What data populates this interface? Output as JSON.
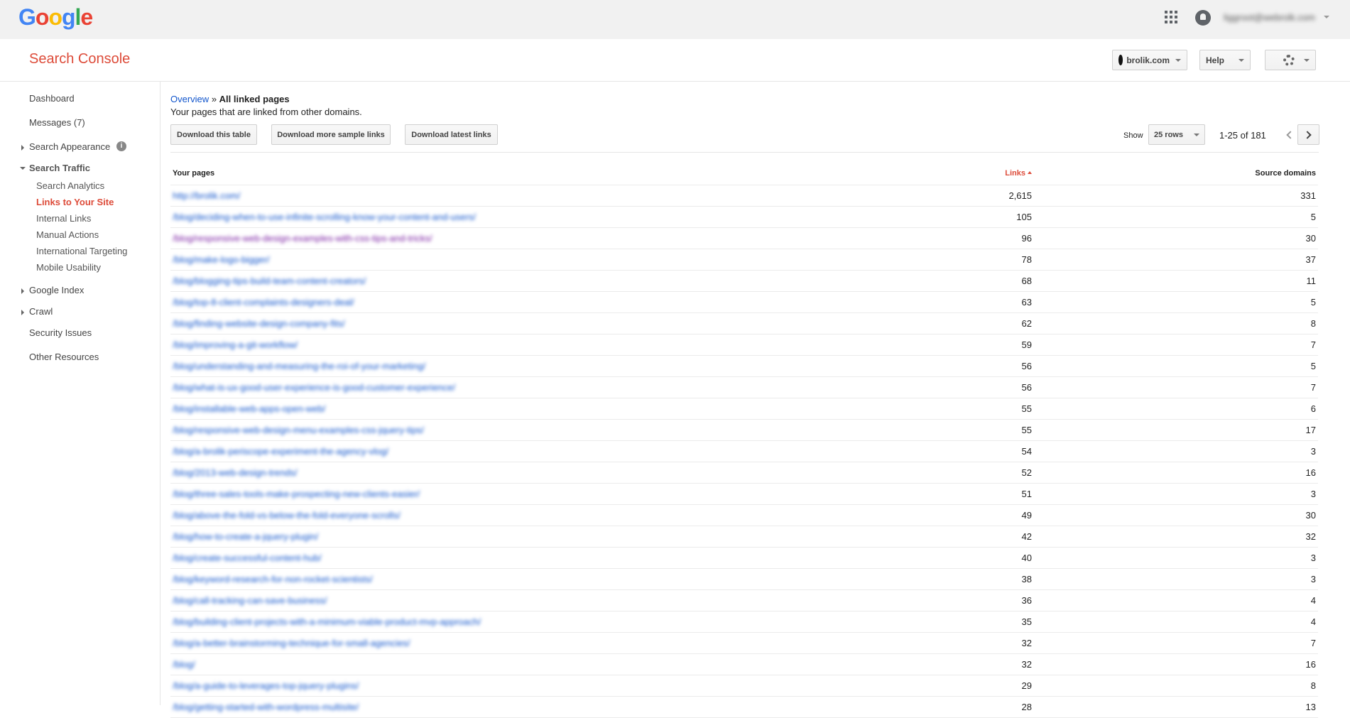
{
  "topbar": {
    "logo_letters": [
      {
        "ch": "G",
        "color": "#4285f4"
      },
      {
        "ch": "o",
        "color": "#ea4335"
      },
      {
        "ch": "o",
        "color": "#fbbc05"
      },
      {
        "ch": "g",
        "color": "#4285f4"
      },
      {
        "ch": "l",
        "color": "#34a853"
      },
      {
        "ch": "e",
        "color": "#ea4335"
      }
    ],
    "icons": [
      "apps-grid-icon",
      "notifications-icon"
    ],
    "account_email": "liggroot@webrolk.com"
  },
  "header": {
    "title": "Search Console",
    "site_label": "brolik.com",
    "help_label": "Help",
    "brand_color": "#dd4b39"
  },
  "sidebar": {
    "dashboard": "Dashboard",
    "messages": "Messages (7)",
    "search_appearance": "Search Appearance",
    "search_traffic": "Search Traffic",
    "search_traffic_items": [
      "Search Analytics",
      "Links to Your Site",
      "Internal Links",
      "Manual Actions",
      "International Targeting",
      "Mobile Usability"
    ],
    "active_item": "Links to Your Site",
    "google_index": "Google Index",
    "crawl": "Crawl",
    "security_issues": "Security Issues",
    "other_resources": "Other Resources"
  },
  "main": {
    "breadcrumb": {
      "overview": "Overview",
      "separator": "»",
      "current": "All linked pages"
    },
    "description": "Your pages that are linked from other domains.",
    "buttons": {
      "download_table": "Download this table",
      "download_sample": "Download more sample links",
      "download_latest": "Download latest links"
    },
    "show_label": "Show",
    "rows_selected": "25 rows",
    "page_range": "1-25 of 181",
    "table": {
      "headers": {
        "pages": "Your pages",
        "links": "Links",
        "domains": "Source domains"
      },
      "sorted_column": "Links",
      "rows": [
        {
          "page": "http://brolik.com/",
          "links": "2,615",
          "domains": "331",
          "visited": false
        },
        {
          "page": "/blog/deciding-when-to-use-infinite-scrolling-know-your-content-and-users/",
          "links": "105",
          "domains": "5",
          "visited": false
        },
        {
          "page": "/blog/responsive-web-design-examples-with-css-tips-and-tricks/",
          "links": "96",
          "domains": "30",
          "visited": true
        },
        {
          "page": "/blog/make-logo-bigger/",
          "links": "78",
          "domains": "37",
          "visited": false
        },
        {
          "page": "/blog/blogging-tips-build-team-content-creators/",
          "links": "68",
          "domains": "11",
          "visited": false
        },
        {
          "page": "/blog/top-8-client-complaints-designers-deal/",
          "links": "63",
          "domains": "5",
          "visited": false
        },
        {
          "page": "/blog/finding-website-design-company-fits/",
          "links": "62",
          "domains": "8",
          "visited": false
        },
        {
          "page": "/blog/improving-a-git-workflow/",
          "links": "59",
          "domains": "7",
          "visited": false
        },
        {
          "page": "/blog/understanding-and-measuring-the-roi-of-your-marketing/",
          "links": "56",
          "domains": "5",
          "visited": false
        },
        {
          "page": "/blog/what-is-ux-good-user-experience-is-good-customer-experience/",
          "links": "56",
          "domains": "7",
          "visited": false
        },
        {
          "page": "/blog/installable-web-apps-open-web/",
          "links": "55",
          "domains": "6",
          "visited": false
        },
        {
          "page": "/blog/responsive-web-design-menu-examples-css-jquery-tips/",
          "links": "55",
          "domains": "17",
          "visited": false
        },
        {
          "page": "/blog/a-brolik-periscope-experiment-the-agency-vlog/",
          "links": "54",
          "domains": "3",
          "visited": false
        },
        {
          "page": "/blog/2013-web-design-trends/",
          "links": "52",
          "domains": "16",
          "visited": false
        },
        {
          "page": "/blog/three-sales-tools-make-prospecting-new-clients-easier/",
          "links": "51",
          "domains": "3",
          "visited": false
        },
        {
          "page": "/blog/above-the-fold-vs-below-the-fold-everyone-scrolls/",
          "links": "49",
          "domains": "30",
          "visited": false
        },
        {
          "page": "/blog/how-to-create-a-jquery-plugin/",
          "links": "42",
          "domains": "32",
          "visited": false
        },
        {
          "page": "/blog/create-successful-content-hub/",
          "links": "40",
          "domains": "3",
          "visited": false
        },
        {
          "page": "/blog/keyword-research-for-non-rocket-scientists/",
          "links": "38",
          "domains": "3",
          "visited": false
        },
        {
          "page": "/blog/call-tracking-can-save-business/",
          "links": "36",
          "domains": "4",
          "visited": false
        },
        {
          "page": "/blog/building-client-projects-with-a-minimum-viable-product-mvp-approach/",
          "links": "35",
          "domains": "4",
          "visited": false
        },
        {
          "page": "/blog/a-better-brainstorming-technique-for-small-agencies/",
          "links": "32",
          "domains": "7",
          "visited": false
        },
        {
          "page": "/blog/",
          "links": "32",
          "domains": "16",
          "visited": false
        },
        {
          "page": "/blog/a-guide-to-leverages-top-jquery-plugins/",
          "links": "29",
          "domains": "8",
          "visited": false
        },
        {
          "page": "/blog/getting-started-with-wordpress-multisite/",
          "links": "28",
          "domains": "13",
          "visited": false
        }
      ]
    }
  }
}
